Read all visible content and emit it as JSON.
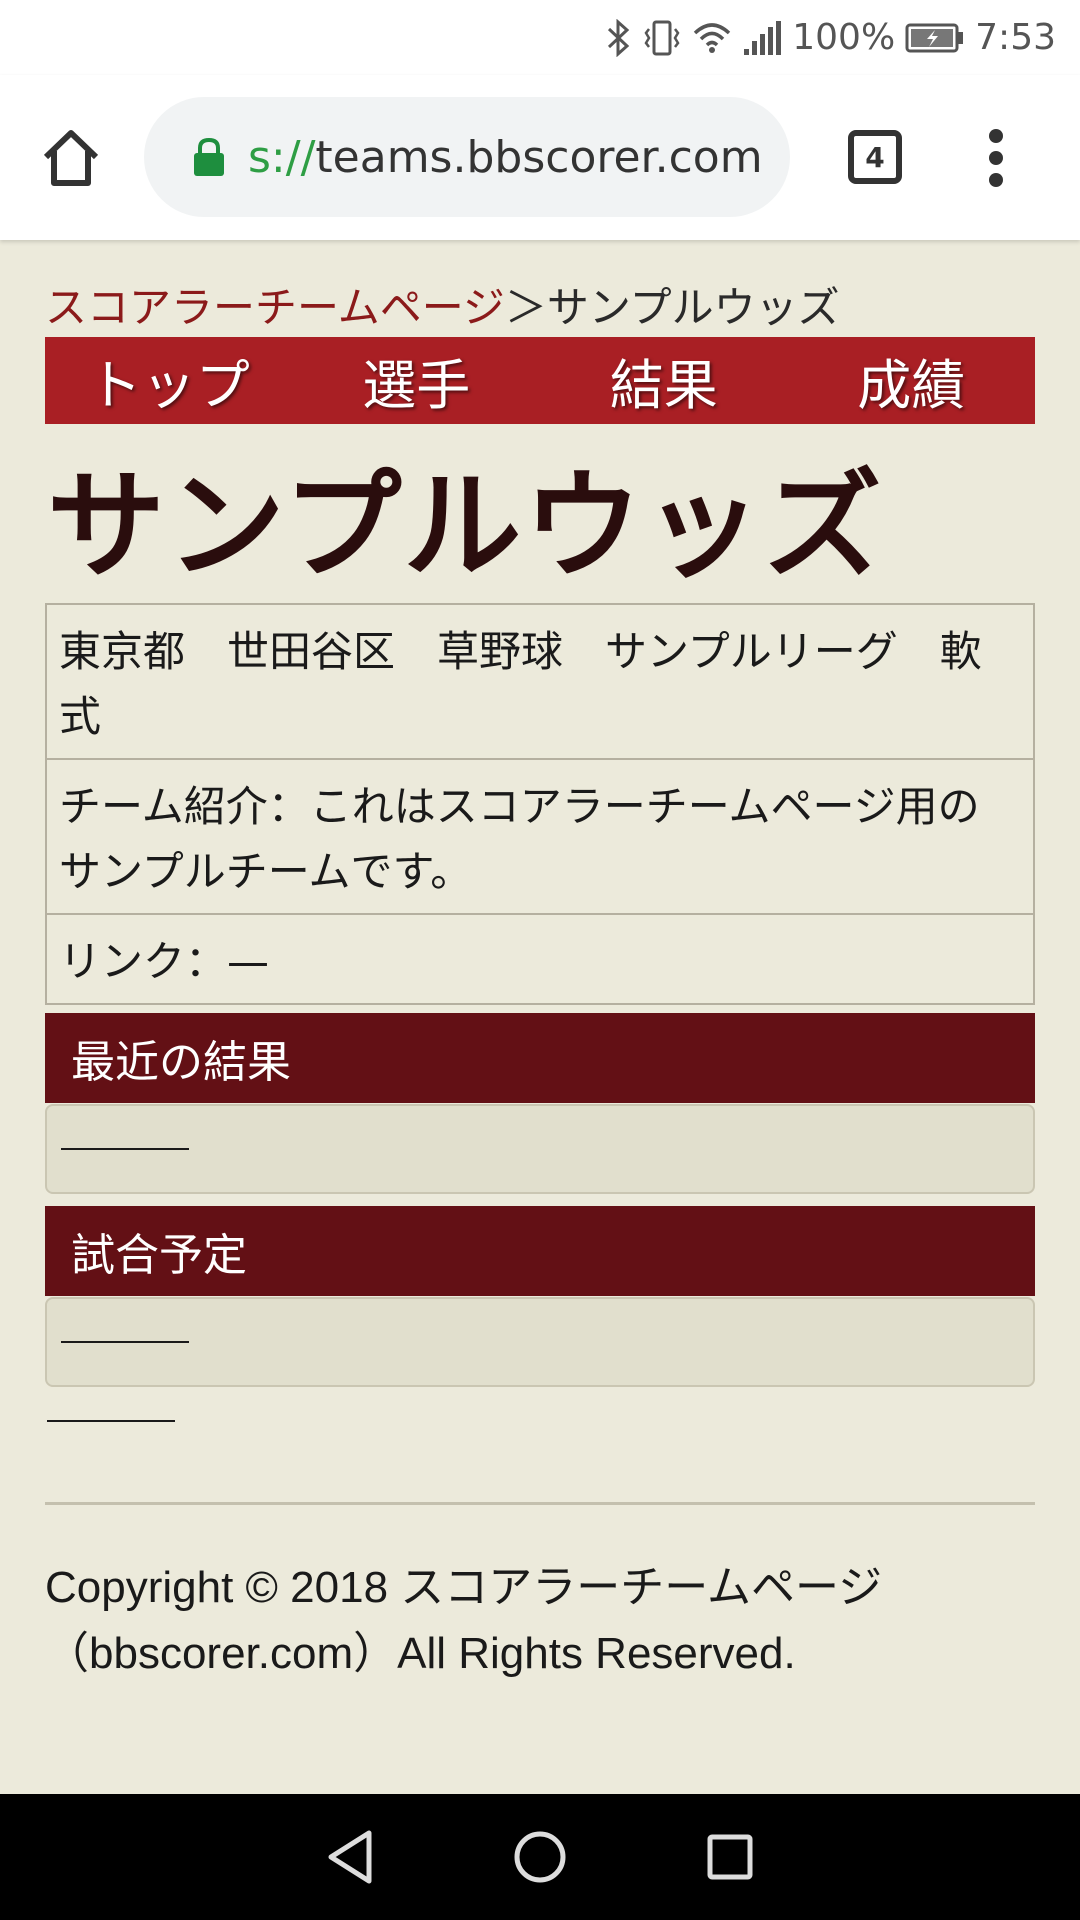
{
  "status_bar": {
    "battery": "100%",
    "time": "7:53"
  },
  "browser": {
    "url_scheme": "s://",
    "url_host": "teams.bbscorer.com",
    "tab_count": "4"
  },
  "breadcrumb": {
    "home_link": "スコアラーチームページ",
    "separator": "＞",
    "current": "サンプルウッズ"
  },
  "nav": {
    "items": [
      {
        "label": "トップ"
      },
      {
        "label": "選手"
      },
      {
        "label": "結果"
      },
      {
        "label": "成績"
      }
    ]
  },
  "team": {
    "name": "サンプルウッズ",
    "info_rows": [
      "東京都　世田谷区　草野球　サンプルリーグ　軟式",
      "チーム紹介：これはスコアラーチームページ用のサンプルチームです。",
      "リンク：—"
    ]
  },
  "sections": {
    "recent_results": "最近の結果",
    "schedule": "試合予定"
  },
  "footer": {
    "line1": "Copyright © 2018 スコアラーチームページ",
    "line2": "（bbscorer.com）All Rights Reserved."
  },
  "colors": {
    "nav_bg": "#a91f24",
    "section_bg": "#631015",
    "page_bg": "#eceadb",
    "link": "#8b1a1a"
  }
}
